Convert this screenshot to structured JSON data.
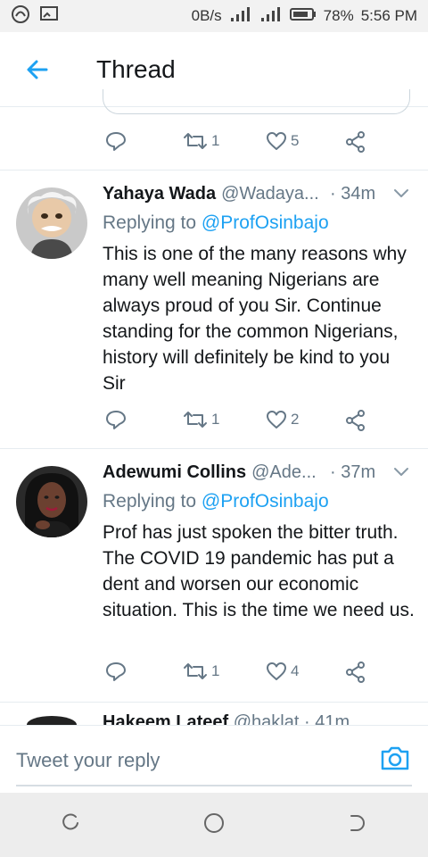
{
  "status_bar": {
    "data_rate": "0B/s",
    "battery": "78%",
    "time": "5:56 PM"
  },
  "app_bar": {
    "title": "Thread"
  },
  "top_tweet_actions": {
    "retweets": "1",
    "likes": "5"
  },
  "tweets": [
    {
      "name": "Yahaya Wada",
      "handle": "@Wadaya...",
      "time": "· 34m",
      "replying_prefix": "Replying to",
      "replying_to": "@ProfOsinbajo",
      "text": "This is one of the many reasons why many well meaning Nigerians are always proud of you Sir. Continue standing for the common Nigerians, history will definitely be kind to you Sir",
      "retweets": "1",
      "likes": "2"
    },
    {
      "name": "Adewumi Collins",
      "handle": "@Ade...",
      "time": "· 37m",
      "replying_prefix": "Replying to",
      "replying_to": "@ProfOsinbajo",
      "text": "Prof has just spoken the bitter truth. The COVID 19 pandemic has put a dent and worsen our economic situation. This is the time we need us.",
      "retweets": "1",
      "likes": "4"
    }
  ],
  "next_tweet_peek": {
    "name": "Hakeem Lateef",
    "handle": "@haklat",
    "time": "· 41m"
  },
  "composer": {
    "placeholder": "Tweet your reply"
  },
  "colors": {
    "accent": "#1da1f2",
    "text": "#14171a",
    "muted": "#657786"
  }
}
